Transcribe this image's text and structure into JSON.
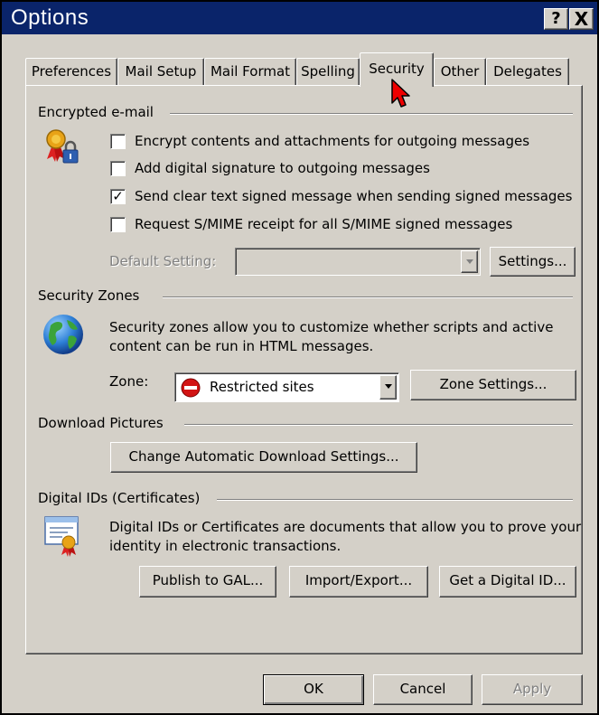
{
  "window": {
    "title": "Options",
    "help_glyph": "?",
    "close_glyph": "X"
  },
  "tabs": [
    {
      "label": "Preferences",
      "active": false
    },
    {
      "label": "Mail Setup",
      "active": false
    },
    {
      "label": "Mail Format",
      "active": false
    },
    {
      "label": "Spelling",
      "active": false
    },
    {
      "label": "Security",
      "active": true
    },
    {
      "label": "Other",
      "active": false
    },
    {
      "label": "Delegates",
      "active": false
    }
  ],
  "encrypted_email": {
    "heading": "Encrypted e-mail",
    "options": [
      {
        "label": "Encrypt contents and attachments for outgoing messages",
        "checked": false
      },
      {
        "label": "Add digital signature to outgoing messages",
        "checked": false
      },
      {
        "label": "Send clear text signed message when sending signed messages",
        "checked": true
      },
      {
        "label": "Request S/MIME receipt for all S/MIME signed messages",
        "checked": false
      }
    ],
    "default_setting_label": "Default Setting:",
    "default_setting_value": "",
    "settings_button": "Settings...",
    "icon": "certificate-lock-icon"
  },
  "security_zones": {
    "heading": "Security Zones",
    "description_line1": "Security zones allow you to customize whether scripts and active",
    "description_line2": "content can be run in HTML messages.",
    "zone_label": "Zone:",
    "zone_value": "Restricted sites",
    "zone_settings_button": "Zone Settings...",
    "icon": "globe-icon"
  },
  "download_pictures": {
    "heading": "Download Pictures",
    "change_button": "Change Automatic Download Settings..."
  },
  "digital_ids": {
    "heading": "Digital IDs (Certificates)",
    "description_line1": "Digital IDs or Certificates are documents that allow you to prove your",
    "description_line2": "identity in electronic transactions.",
    "publish_button": "Publish to GAL...",
    "import_export_button": "Import/Export...",
    "get_id_button": "Get a Digital ID...",
    "icon": "certificate-document-icon"
  },
  "footer": {
    "ok": "OK",
    "cancel": "Cancel",
    "apply": "Apply"
  },
  "colors": {
    "titlebar": "#0a246a",
    "face": "#d4d0c8"
  }
}
